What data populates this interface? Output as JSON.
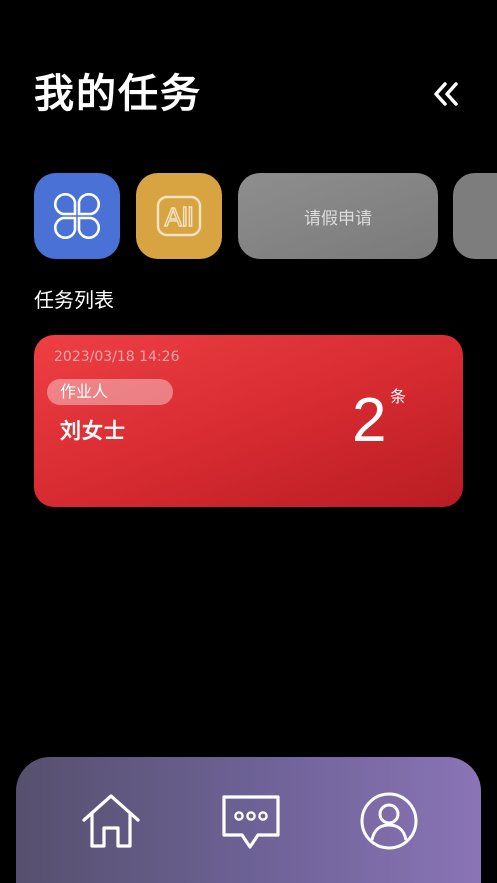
{
  "header": {
    "title": "我的任务",
    "collapse_icon": "double-chevron-left-icon"
  },
  "quick_actions": {
    "grid_icon": "four-petal-grid-icon",
    "all_icon": "all-text-icon",
    "all_label": "All",
    "leave_label": "请假申请",
    "colors": {
      "grid": "#4a72d6",
      "all": "#d8a442",
      "leave": "#8a8a8a"
    }
  },
  "tasks": {
    "section_label": "任务列表",
    "items": [
      {
        "date": "2023/03/18 14:26",
        "role": "作业人",
        "name": "刘女士",
        "count": "2",
        "unit": "条",
        "color": "#d52a30"
      }
    ]
  },
  "bottom_nav": {
    "items": [
      {
        "icon": "home-icon"
      },
      {
        "icon": "chat-bubble-icon"
      },
      {
        "icon": "user-profile-icon"
      }
    ]
  }
}
